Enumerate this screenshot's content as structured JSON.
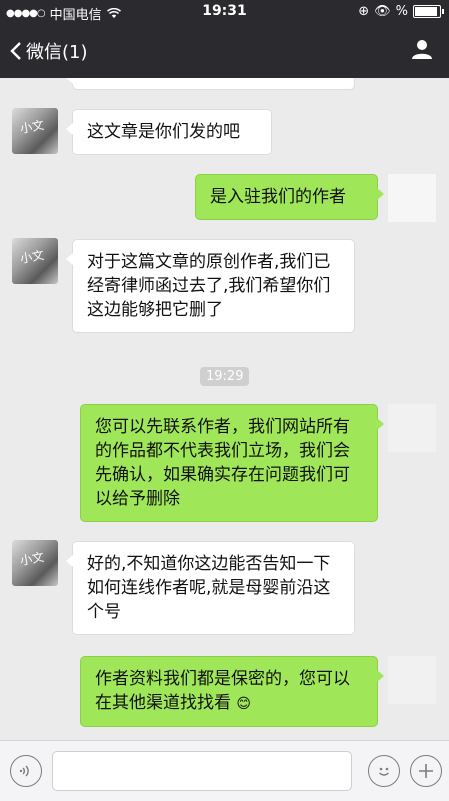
{
  "status_bar": {
    "carrier": "中国电信",
    "time": "19:31",
    "battery_text": "%"
  },
  "nav": {
    "back_label": "微信(1)"
  },
  "messages": [
    {
      "side": "in",
      "text": "这文章是你们发的吧"
    },
    {
      "side": "out",
      "text": "是入驻我们的作者"
    },
    {
      "side": "in",
      "text": "对于这篇文章的原创作者,我们已经寄律师函过去了,我们希望你们这边能够把它删了"
    },
    {
      "side": "out",
      "text": "您可以先联系作者，我们网站所有的作品都不代表我们立场，我们会先确认，如果确实存在问题我们可以给予删除"
    },
    {
      "side": "in",
      "text": "好的,不知道你这边能否告知一下如何连线作者呢,就是母婴前沿这个号"
    },
    {
      "side": "out",
      "text": "作者资料我们都是保密的，您可以在其他渠道找找看"
    }
  ],
  "timestamp": "19:29",
  "avatar_text": "小文"
}
